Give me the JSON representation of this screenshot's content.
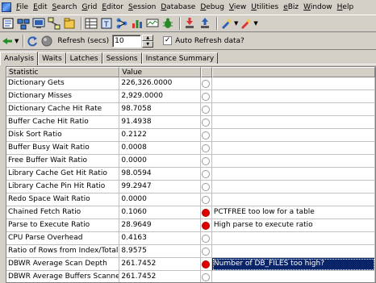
{
  "menu": [
    "File",
    "Edit",
    "Search",
    "Grid",
    "Editor",
    "Session",
    "Database",
    "Debug",
    "View",
    "Utilities",
    "eBiz",
    "Window",
    "Help"
  ],
  "toolbar2": {
    "refresh_label": "Refresh (secs)",
    "refresh_value": "10",
    "auto_refresh_label": "Auto Refresh data?",
    "auto_refresh_checked": true
  },
  "tabs": [
    "Analysis",
    "Waits",
    "Latches",
    "Sessions",
    "Instance Summary"
  ],
  "grid": {
    "headers": [
      "Statistic",
      "Value",
      "",
      ""
    ],
    "rows": [
      {
        "statistic": "Dictionary Gets",
        "value": "226,326.0000",
        "led": "off",
        "message": ""
      },
      {
        "statistic": "Dictionary Misses",
        "value": "2,929.0000",
        "led": "off",
        "message": ""
      },
      {
        "statistic": "Dictionary Cache Hit Rate",
        "value": "98.7058",
        "led": "off",
        "message": ""
      },
      {
        "statistic": "Buffer Cache Hit Ratio",
        "value": "91.4938",
        "led": "off",
        "message": ""
      },
      {
        "statistic": "Disk Sort Ratio",
        "value": "0.2122",
        "led": "off",
        "message": ""
      },
      {
        "statistic": "Buffer Busy Wait Ratio",
        "value": "0.0008",
        "led": "off",
        "message": ""
      },
      {
        "statistic": "Free Buffer Wait Ratio",
        "value": "0.0000",
        "led": "off",
        "message": ""
      },
      {
        "statistic": "Library Cache Get Hit Ratio",
        "value": "98.0594",
        "led": "off",
        "message": ""
      },
      {
        "statistic": "Library Cache Pin Hit Ratio",
        "value": "99.2947",
        "led": "off",
        "message": ""
      },
      {
        "statistic": "Redo Space Wait Ratio",
        "value": "0.0000",
        "led": "off",
        "message": ""
      },
      {
        "statistic": "Chained Fetch Ratio",
        "value": "0.1060",
        "led": "red",
        "message": "PCTFREE too low for a table"
      },
      {
        "statistic": "Parse to Execute Ratio",
        "value": "28.9649",
        "led": "red",
        "message": "High parse to execute ratio"
      },
      {
        "statistic": "CPU Parse Overhead",
        "value": "0.4163",
        "led": "off",
        "message": ""
      },
      {
        "statistic": "Ratio of Rows from Index/Total Rows",
        "value": "8.9575",
        "led": "off",
        "message": ""
      },
      {
        "statistic": "DBWR Average Scan Depth",
        "value": "261.7452",
        "led": "red",
        "message": "Number of DB_FILES too high?"
      },
      {
        "statistic": "DBWR Average Buffers Scanned",
        "value": "261.7452",
        "led": "off",
        "message": ""
      }
    ]
  },
  "colors": {
    "alert": "#e00000",
    "selection": "#0a246a",
    "chrome": "#d4d0c8"
  }
}
